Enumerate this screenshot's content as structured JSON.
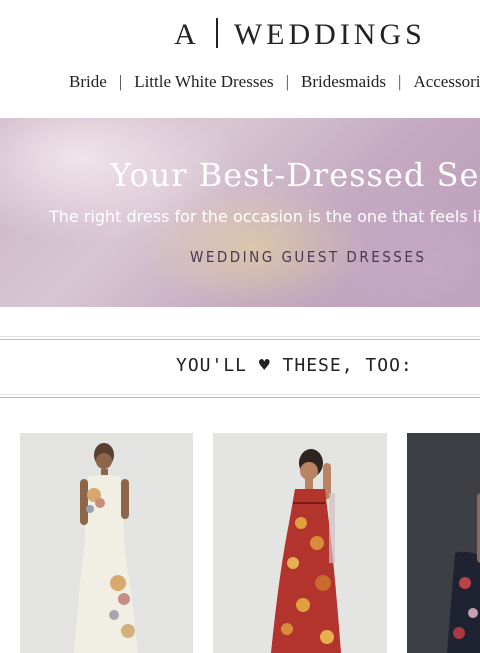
{
  "brand": {
    "left": "A",
    "right": "WEDDINGS"
  },
  "nav": {
    "items": [
      "Bride",
      "Little White Dresses",
      "Bridesmaids",
      "Accessories"
    ]
  },
  "hero": {
    "title": "Your Best-Dressed Self",
    "subtitle": "The right dress for the occasion is the one that feels like you",
    "cta": "WEDDING GUEST DRESSES"
  },
  "section": {
    "title": "YOU'LL ♥ THESE, TOO:"
  },
  "products": [
    {
      "image": "ivory-floral-maxi-dress",
      "background": "#e3e4e2"
    },
    {
      "image": "red-floral-halter-dress",
      "background": "#e4e4e2"
    },
    {
      "image": "dark-floral-dress",
      "background": "#3d3f44"
    }
  ],
  "colors": {
    "text": "#222222",
    "hero_text": "#ffffff",
    "cta": "#4a3850",
    "rule": "#bdbdbd"
  }
}
